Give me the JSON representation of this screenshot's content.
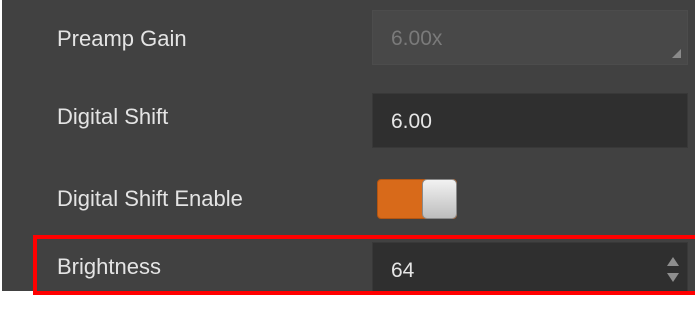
{
  "properties": [
    {
      "label": "Preamp Gain",
      "value": "6.00x",
      "state": "disabled"
    },
    {
      "label": "Digital Shift",
      "value": "6.00",
      "state": "editable"
    },
    {
      "label": "Digital Shift Enable",
      "toggle_on": true,
      "toggle_color": "#d86a1a"
    },
    {
      "label": "Brightness",
      "value": "64",
      "state": "spinbox",
      "highlighted": true
    }
  ],
  "colors": {
    "panel_bg": "#414141",
    "highlight": "#ff0000"
  }
}
